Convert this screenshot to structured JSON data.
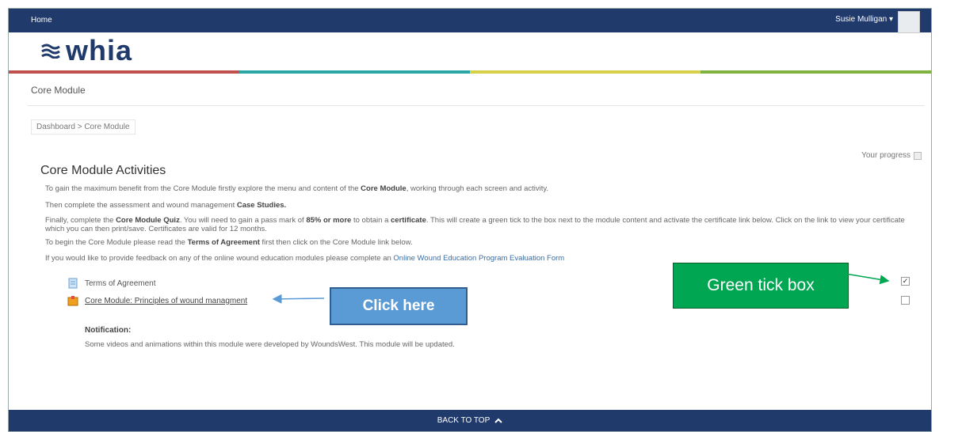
{
  "topbar": {
    "home_label": "Home",
    "user_name": "Susie Mulligan ▾"
  },
  "logo": {
    "text": "whia"
  },
  "colors": {
    "navy": "#1f3a6b",
    "stripe": [
      "#c0504d",
      "#2aa6a4",
      "#d8cf4a",
      "#7fb23f"
    ],
    "callout_green": "#00a651",
    "callout_blue": "#5b9bd5"
  },
  "section_title": "Core Module",
  "breadcrumb": {
    "items": [
      "Dashboard",
      ">",
      "Core Module"
    ]
  },
  "progress_label": "Your progress",
  "page_heading": "Core Module Activities",
  "paragraphs": {
    "p1": {
      "a": "To gain the maximum benefit from the Core Module firstly explore the menu and content of the ",
      "b": "Core Module",
      "c": ", working through each screen and activity."
    },
    "p2": {
      "a": "Then complete the assessment and wound management ",
      "b": "Case Studies."
    },
    "p3": {
      "a": "Finally, complete the ",
      "b": "Core Module Quiz",
      "c": ". You will need to gain a pass mark of ",
      "d": "85% or more",
      "e": " to obtain a ",
      "f": "certificate",
      "g": ". This will create a green tick to the box next to the module content and activate the certificate link below. Click on the link to view your certificate which you can then print/save. Certificates are valid for 12 months."
    },
    "p4": {
      "a": "To begin the Core Module please read the ",
      "b": "Terms of Agreement",
      "c": " first then click on the Core Module link below."
    },
    "p5": {
      "a": "If you would like to provide feedback on any of the online wound education modules please complete an ",
      "link": "Online Wound Education Program Evaluation Form"
    }
  },
  "activities": [
    {
      "label": "Terms of Agreement",
      "icon": "document-icon",
      "completed": true
    },
    {
      "label": "Core Module: Principles of wound managment",
      "icon": "module-package-icon",
      "completed": false
    }
  ],
  "notification": {
    "heading": "Notification:",
    "text": "Some videos and animations within this module were developed by WoundsWest.  This module will be updated."
  },
  "callouts": {
    "green": "Green tick box",
    "blue": "Click here"
  },
  "footer": {
    "back_to_top": "BACK TO TOP"
  }
}
